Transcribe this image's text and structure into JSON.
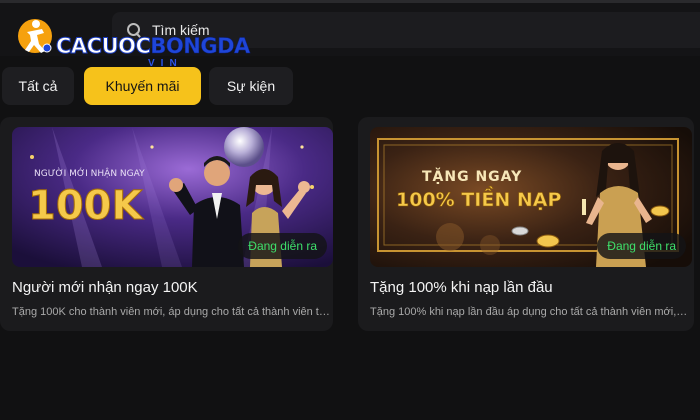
{
  "search": {
    "placeholder": "Tìm kiếm"
  },
  "logo": {
    "part1": "CACUOC",
    "part2": "BONGDA",
    "sub": "VIN"
  },
  "tabs": [
    {
      "label": "Tất cả",
      "active": false
    },
    {
      "label": "Khuyến mãi",
      "active": true
    },
    {
      "label": "Sự kiện",
      "active": false
    }
  ],
  "promotions": [
    {
      "title": "Người mới nhận ngay 100K",
      "description": "Tặng 100K cho thành viên mới, áp dụng cho tất cả thành viên tại ...",
      "status": "Đang diễn ra",
      "banner_small": "NGƯỜI MỚI NHẬN NGAY",
      "banner_big": "100K"
    },
    {
      "title": "Tặng 100% khi nạp lần đầu",
      "description": "Tặng 100% khi nạp lần đầu áp dụng cho tất cả thành viên mới, n...",
      "status": "Đang diễn ra",
      "banner_small": "TẶNG NGAY",
      "banner_big": "100% TIỀN NẠP"
    }
  ],
  "colors": {
    "accent": "#f6c21b",
    "status": "#3ee06b",
    "background": "#111112"
  }
}
